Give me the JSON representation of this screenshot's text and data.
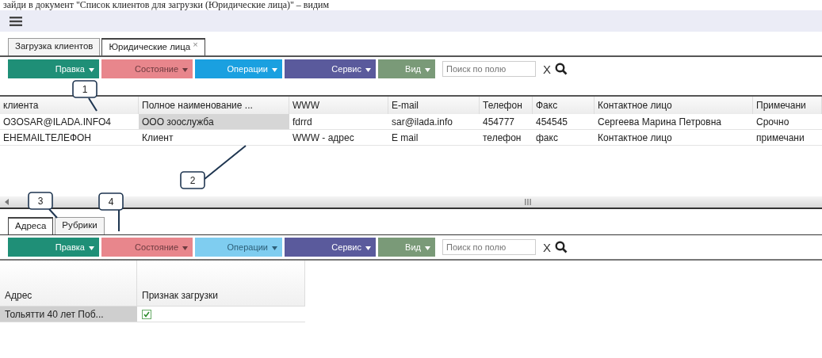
{
  "doc_line": "зайди в документ \"Список клиентов для загрузки (Юридические лица)\" – видим",
  "tabs": [
    {
      "label": "Загрузка клиентов",
      "selected": false
    },
    {
      "label": "Юридические лица",
      "selected": true,
      "close": "×"
    }
  ],
  "toolbar": {
    "menus": [
      {
        "label": "Правка",
        "color": "#1f8f77",
        "disabled": false
      },
      {
        "label": "Состояние",
        "color": "#e8868c",
        "disabled": true
      },
      {
        "label": "Операции",
        "color": "#1aa0e0",
        "disabled": false
      },
      {
        "label": "Сервис",
        "color": "#5a5a9c",
        "disabled": false
      },
      {
        "label": "Вид",
        "color": "#7a9a78",
        "disabled": false
      }
    ],
    "search": {
      "placeholder": "Поиск по полю"
    },
    "clear": "X"
  },
  "table": {
    "columns": [
      "клиента",
      "Полное наименование ...",
      "WWW",
      "E-mail",
      "Телефон",
      "Факс",
      "Контактное лицо",
      "Примечани"
    ],
    "rows": [
      {
        "cells": [
          {
            "text": "ОЗОSAR@ILADA.INFO4",
            "selected": false
          },
          {
            "text": "ООО зоослужба",
            "selected": true
          },
          {
            "text": "fdrrd",
            "selected": false
          },
          {
            "text": "sar@ilada.info",
            "selected": false
          },
          {
            "text": "454777",
            "selected": false
          },
          {
            "text": "454545",
            "selected": false
          },
          {
            "text": "Сергеева Марина Петровна",
            "selected": false
          },
          {
            "text": "Срочно",
            "selected": false
          }
        ]
      },
      {
        "cells": [
          {
            "text": "ЕНЕМAILТЕЛЕФОН",
            "selected": false
          },
          {
            "text": "Клиент",
            "selected": false
          },
          {
            "text": "WWW - адрес",
            "selected": false
          },
          {
            "text": "E mail",
            "selected": false
          },
          {
            "text": "телефон",
            "selected": false
          },
          {
            "text": "факс",
            "selected": false
          },
          {
            "text": "Контактное лицо",
            "selected": false
          },
          {
            "text": "примечани",
            "selected": false
          }
        ]
      }
    ]
  },
  "sub_tabs": [
    {
      "label": "Адреса",
      "selected": true
    },
    {
      "label": "Рубрики",
      "selected": false
    }
  ],
  "sub_toolbar": {
    "menus": [
      {
        "label": "Правка",
        "color": "#1f8f77",
        "disabled": false
      },
      {
        "label": "Состояние",
        "color": "#e8868c",
        "disabled": true
      },
      {
        "label": "Операции",
        "color": "#7fcdf0",
        "disabled": true
      },
      {
        "label": "Сервис",
        "color": "#5a5a9c",
        "disabled": false
      },
      {
        "label": "Вид",
        "color": "#7a9a78",
        "disabled": false
      }
    ],
    "search": {
      "placeholder": "Поиск по полю"
    },
    "clear": "X"
  },
  "sub_table": {
    "columns": [
      "Адрес",
      "Признак загрузки"
    ],
    "rows": [
      {
        "address": "Тольятти 40 лет Поб...",
        "selected": true,
        "checked": true
      }
    ]
  },
  "callouts": [
    "1",
    "2",
    "3",
    "4"
  ]
}
